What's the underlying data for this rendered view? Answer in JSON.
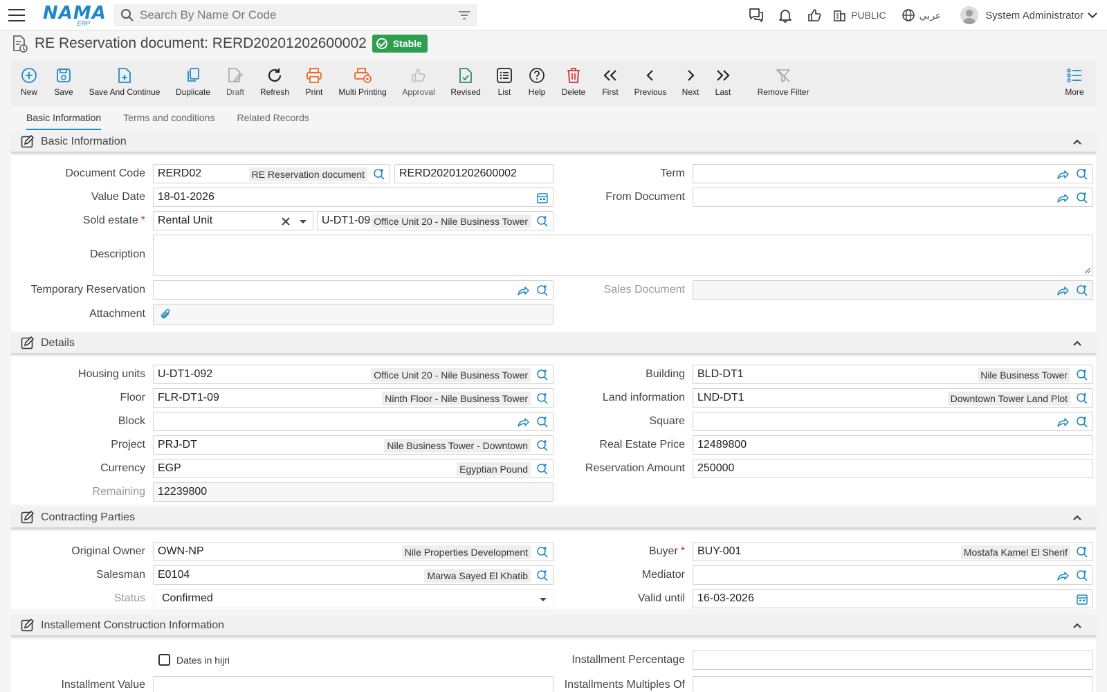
{
  "header": {
    "search_placeholder": "Search By Name Or Code",
    "logo_main": "NAMA",
    "logo_sub": "ERP",
    "public_label": "PUBLIC",
    "language_label": "عربي",
    "user_name": "System Administrator"
  },
  "document": {
    "title": "RE Reservation document: RERD20201202600002",
    "status": "Stable"
  },
  "toolbar": {
    "new": "New",
    "save": "Save",
    "save_continue": "Save And Continue",
    "duplicate": "Duplicate",
    "draft": "Draft",
    "refresh": "Refresh",
    "print": "Print",
    "multi_printing": "Multi Printing",
    "approval": "Approval",
    "revised": "Revised",
    "list": "List",
    "help": "Help",
    "delete": "Delete",
    "first": "First",
    "previous": "Previous",
    "next": "Next",
    "last": "Last",
    "remove_filter": "Remove Filter",
    "more": "More"
  },
  "tabs": [
    "Basic Information",
    "Terms and conditions",
    "Related Records"
  ],
  "basic": {
    "section_title": "Basic Information",
    "document_code_label": "Document Code",
    "document_code_value": "RERD02",
    "document_code_desc": "RE Reservation document",
    "document_number": "RERD20201202600002",
    "term_label": "Term",
    "value_date_label": "Value Date",
    "value_date": "18-01-2026",
    "from_document_label": "From Document",
    "sold_estate_label": "Sold estate",
    "sold_estate_type": "Rental Unit",
    "sold_estate_code": "U-DT1-09",
    "sold_estate_desc": "Office Unit 20 - Nile Business Tower",
    "description_label": "Description",
    "temp_reservation_label": "Temporary Reservation",
    "sales_document_label": "Sales Document",
    "attachment_label": "Attachment"
  },
  "details": {
    "section_title": "Details",
    "housing_units_label": "Housing units",
    "housing_units_value": "U-DT1-092",
    "housing_units_desc": "Office Unit 20 - Nile Business Tower",
    "building_label": "Building",
    "building_value": "BLD-DT1",
    "building_desc": "Nile Business Tower",
    "floor_label": "Floor",
    "floor_value": "FLR-DT1-09",
    "floor_desc": "Ninth Floor - Nile Business Tower",
    "land_label": "Land information",
    "land_value": "LND-DT1",
    "land_desc": "Downtown Tower Land Plot",
    "block_label": "Block",
    "square_label": "Square",
    "project_label": "Project",
    "project_value": "PRJ-DT",
    "project_desc": "Nile Business Tower - Downtown",
    "price_label": "Real Estate Price",
    "price_value": "12489800",
    "currency_label": "Currency",
    "currency_value": "EGP",
    "currency_desc": "Egyptian Pound",
    "reservation_amount_label": "Reservation Amount",
    "reservation_amount_value": "250000",
    "remaining_label": "Remaining",
    "remaining_value": "12239800"
  },
  "parties": {
    "section_title": "Contracting Parties",
    "owner_label": "Original Owner",
    "owner_value": "OWN-NP",
    "owner_desc": "Nile Properties Development",
    "buyer_label": "Buyer",
    "buyer_value": "BUY-001",
    "buyer_desc": "Mostafa Kamel El Sherif",
    "salesman_label": "Salesman",
    "salesman_value": "E0104",
    "salesman_desc": "Marwa Sayed El Khatib",
    "mediator_label": "Mediator",
    "status_label": "Status",
    "status_value": "Confirmed",
    "valid_until_label": "Valid until",
    "valid_until_value": "16-03-2026"
  },
  "installment": {
    "section_title": "Installement Construction Information",
    "hijri_label": "Dates in hijri",
    "percentage_label": "Installment Percentage",
    "value_label": "Installment Value",
    "multiples_label": "Installments Multiples Of"
  },
  "colors": {
    "accent": "#1e88c7",
    "status_green": "#2e9e4f",
    "print_orange": "#e8672a",
    "delete_red": "#d0312d",
    "revised_green": "#2e8b57"
  }
}
